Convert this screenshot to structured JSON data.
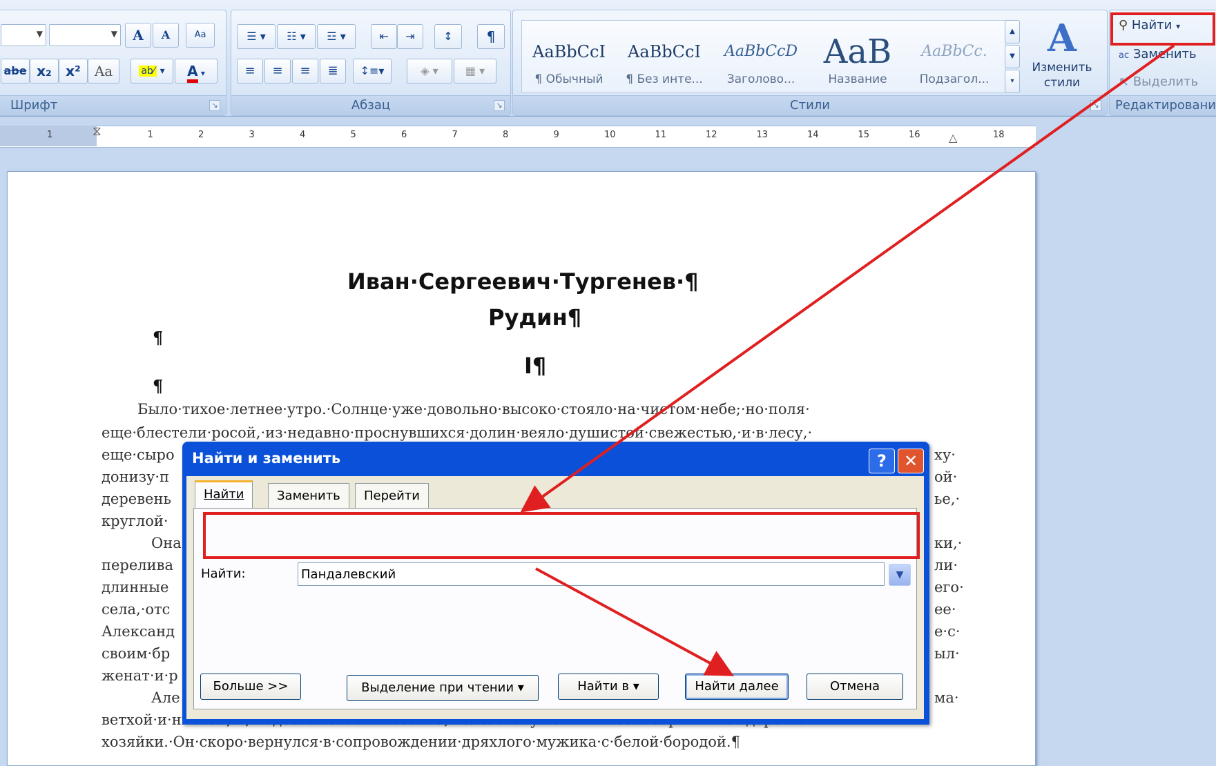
{
  "ribbon": {
    "font_group": {
      "label": "Шрифт",
      "grow_font": "A",
      "shrink_font": "A",
      "clear_format": "",
      "strikethrough": "abe",
      "subscript": "x₂",
      "superscript": "x²",
      "change_case": "Aa",
      "highlight": "ab⁄",
      "font_color": "A"
    },
    "paragraph_group": {
      "label": "Абзац"
    },
    "styles_group": {
      "label": "Стили",
      "styles": [
        {
          "sample": "AaBbCcI",
          "name": "¶ Обычный"
        },
        {
          "sample": "AaBbCcI",
          "name": "¶ Без инте..."
        },
        {
          "sample": "AaBbCcD",
          "name": "Заголово..."
        },
        {
          "sample": "AaB",
          "name": "Название"
        },
        {
          "sample": "AaBbCc.",
          "name": "Подзагол..."
        }
      ],
      "change_styles": "Изменить стили"
    },
    "editing_group": {
      "label": "Редактирование",
      "find": "Найти",
      "replace": "Заменить",
      "select": "Выделить"
    }
  },
  "ruler": {
    "ticks": [
      "1",
      "1",
      "2",
      "3",
      "4",
      "5",
      "6",
      "7",
      "8",
      "9",
      "10",
      "11",
      "12",
      "13",
      "14",
      "15",
      "16",
      "18"
    ]
  },
  "document": {
    "author": "Иван·Сергеевич·Тургенев·¶",
    "title": "Рудин¶",
    "chapter": "I¶",
    "pilcrow": "¶",
    "lines": [
      "Было·тихое·летнее·утро.·Солнце·уже·довольно·высоко·стояло·на·чистом·небе;·но·поля·",
      "еще·блестели·росой,·из·недавно·проснувшихся·долин·веяло·душистой·свежестью,·и·в·лесу,·",
      "еще·сыро",
      "донизу·п",
      "деревень",
      "круглой·",
      "Она",
      "перелива",
      "длинные",
      "села,·отс",
      "Александ",
      "своим·бр",
      "женат·и·р",
      "Але",
      "ветхой·и·низкой,·и,·подозвав·своего·казачка,·велела·ему·войти·в·нее·и·спросить·о·здоровье·",
      "хозяйки.·Он·скоро·вернулся·в·сопровождении·дряхлого·мужика·с·белой·бородой.¶"
    ],
    "right_fragments": [
      "ху·",
      "ой·",
      "ье,·",
      "ки,·",
      "ли·",
      "его·",
      "ее·",
      "е·с·",
      "ыл·",
      "ма·"
    ]
  },
  "dialog": {
    "title": "Найти и заменить",
    "help": "?",
    "close": "✕",
    "tabs": [
      "Найти",
      "Заменить",
      "Перейти"
    ],
    "find_label": "Найти:",
    "find_value": "Пандалевский",
    "buttons": {
      "more": "Больше >>",
      "reading_highlight": "Выделение при чтении ▾",
      "find_in": "Найти в ▾",
      "find_next": "Найти далее",
      "cancel": "Отмена"
    }
  },
  "colors": {
    "annotation_red": "#e02020",
    "dialog_title_blue": "#0a50d8"
  }
}
